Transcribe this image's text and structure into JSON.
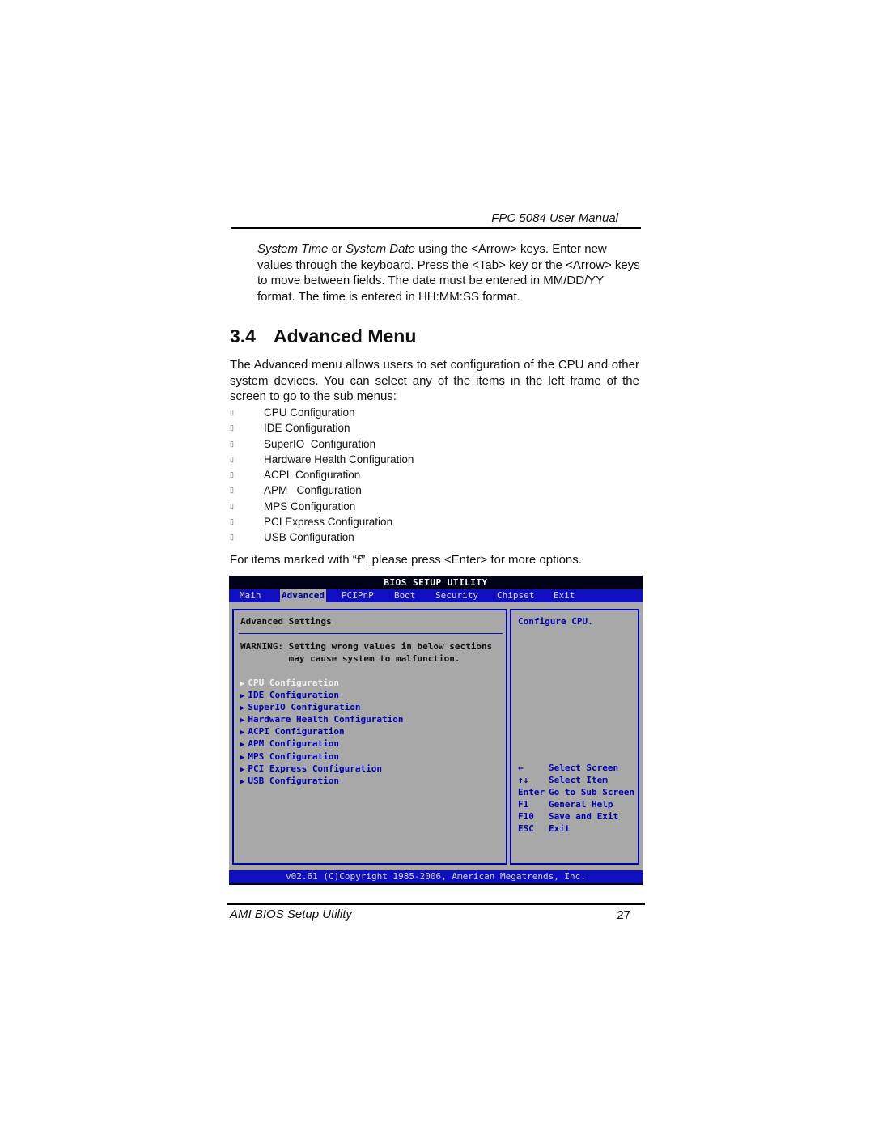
{
  "header": {
    "title": "FPC 5084 User Manual"
  },
  "intro": {
    "em1": "System Time",
    "or": " or ",
    "em2": "System Date",
    "rest": " using the <Arrow> keys. Enter new values through the keyboard. Press the <Tab> key or the <Arrow> keys to move between fields. The date must be entered in MM/DD/YY format. The time is entered in HH:MM:SS format."
  },
  "section": {
    "number": "3.4",
    "title": "Advanced Menu"
  },
  "description": "The Advanced menu allows users to set configuration of the CPU and other system devices. You can select any of the items in the left frame of the screen to go to the sub menus:",
  "bullet_glyph": "▯",
  "bullets": [
    "CPU Configuration",
    "IDE Configuration",
    "SuperIO  Configuration",
    "Hardware Health Configuration",
    "ACPI  Configuration",
    "APM   Configuration",
    "MPS Configuration",
    "PCI Express Configuration",
    "USB Configuration"
  ],
  "note": {
    "before": "For items marked with “",
    "glyph": "f",
    "after": "”, please press <Enter> for more options."
  },
  "bios": {
    "title": "BIOS SETUP UTILITY",
    "tabs": [
      "Main",
      "Advanced",
      "PCIPnP",
      "Boot",
      "Security",
      "Chipset",
      "Exit"
    ],
    "active_tab": "Advanced",
    "left_pane": {
      "heading": "Advanced Settings",
      "warning": "WARNING: Setting wrong values in below sections\n         may cause system to malfunction.",
      "items": [
        "CPU Configuration",
        "IDE Configuration",
        "SuperIO Configuration",
        "Hardware Health Configuration",
        "ACPI Configuration",
        "APM Configuration",
        "MPS Configuration",
        "PCI Express Configuration",
        "USB Configuration"
      ],
      "selected_item": "CPU Configuration",
      "item_marker": "▶"
    },
    "right_pane": {
      "help": "Configure CPU.",
      "keys": [
        {
          "key": "←",
          "action": "Select Screen"
        },
        {
          "key": "↑↓",
          "action": "Select Item"
        },
        {
          "key": "Enter",
          "action": "Go to Sub Screen"
        },
        {
          "key": "F1",
          "action": "General Help"
        },
        {
          "key": "F10",
          "action": "Save and Exit"
        },
        {
          "key": "ESC",
          "action": "Exit"
        }
      ]
    },
    "footer": "v02.61 (C)Copyright 1985-2006, American Megatrends, Inc.",
    "colors": {
      "bar": "#0f0fc0",
      "background": "#a8a8a8",
      "text": "#0000b0",
      "title_bar": "#000018"
    }
  },
  "footer": {
    "left": "AMI BIOS Setup Utility",
    "page": "27"
  }
}
